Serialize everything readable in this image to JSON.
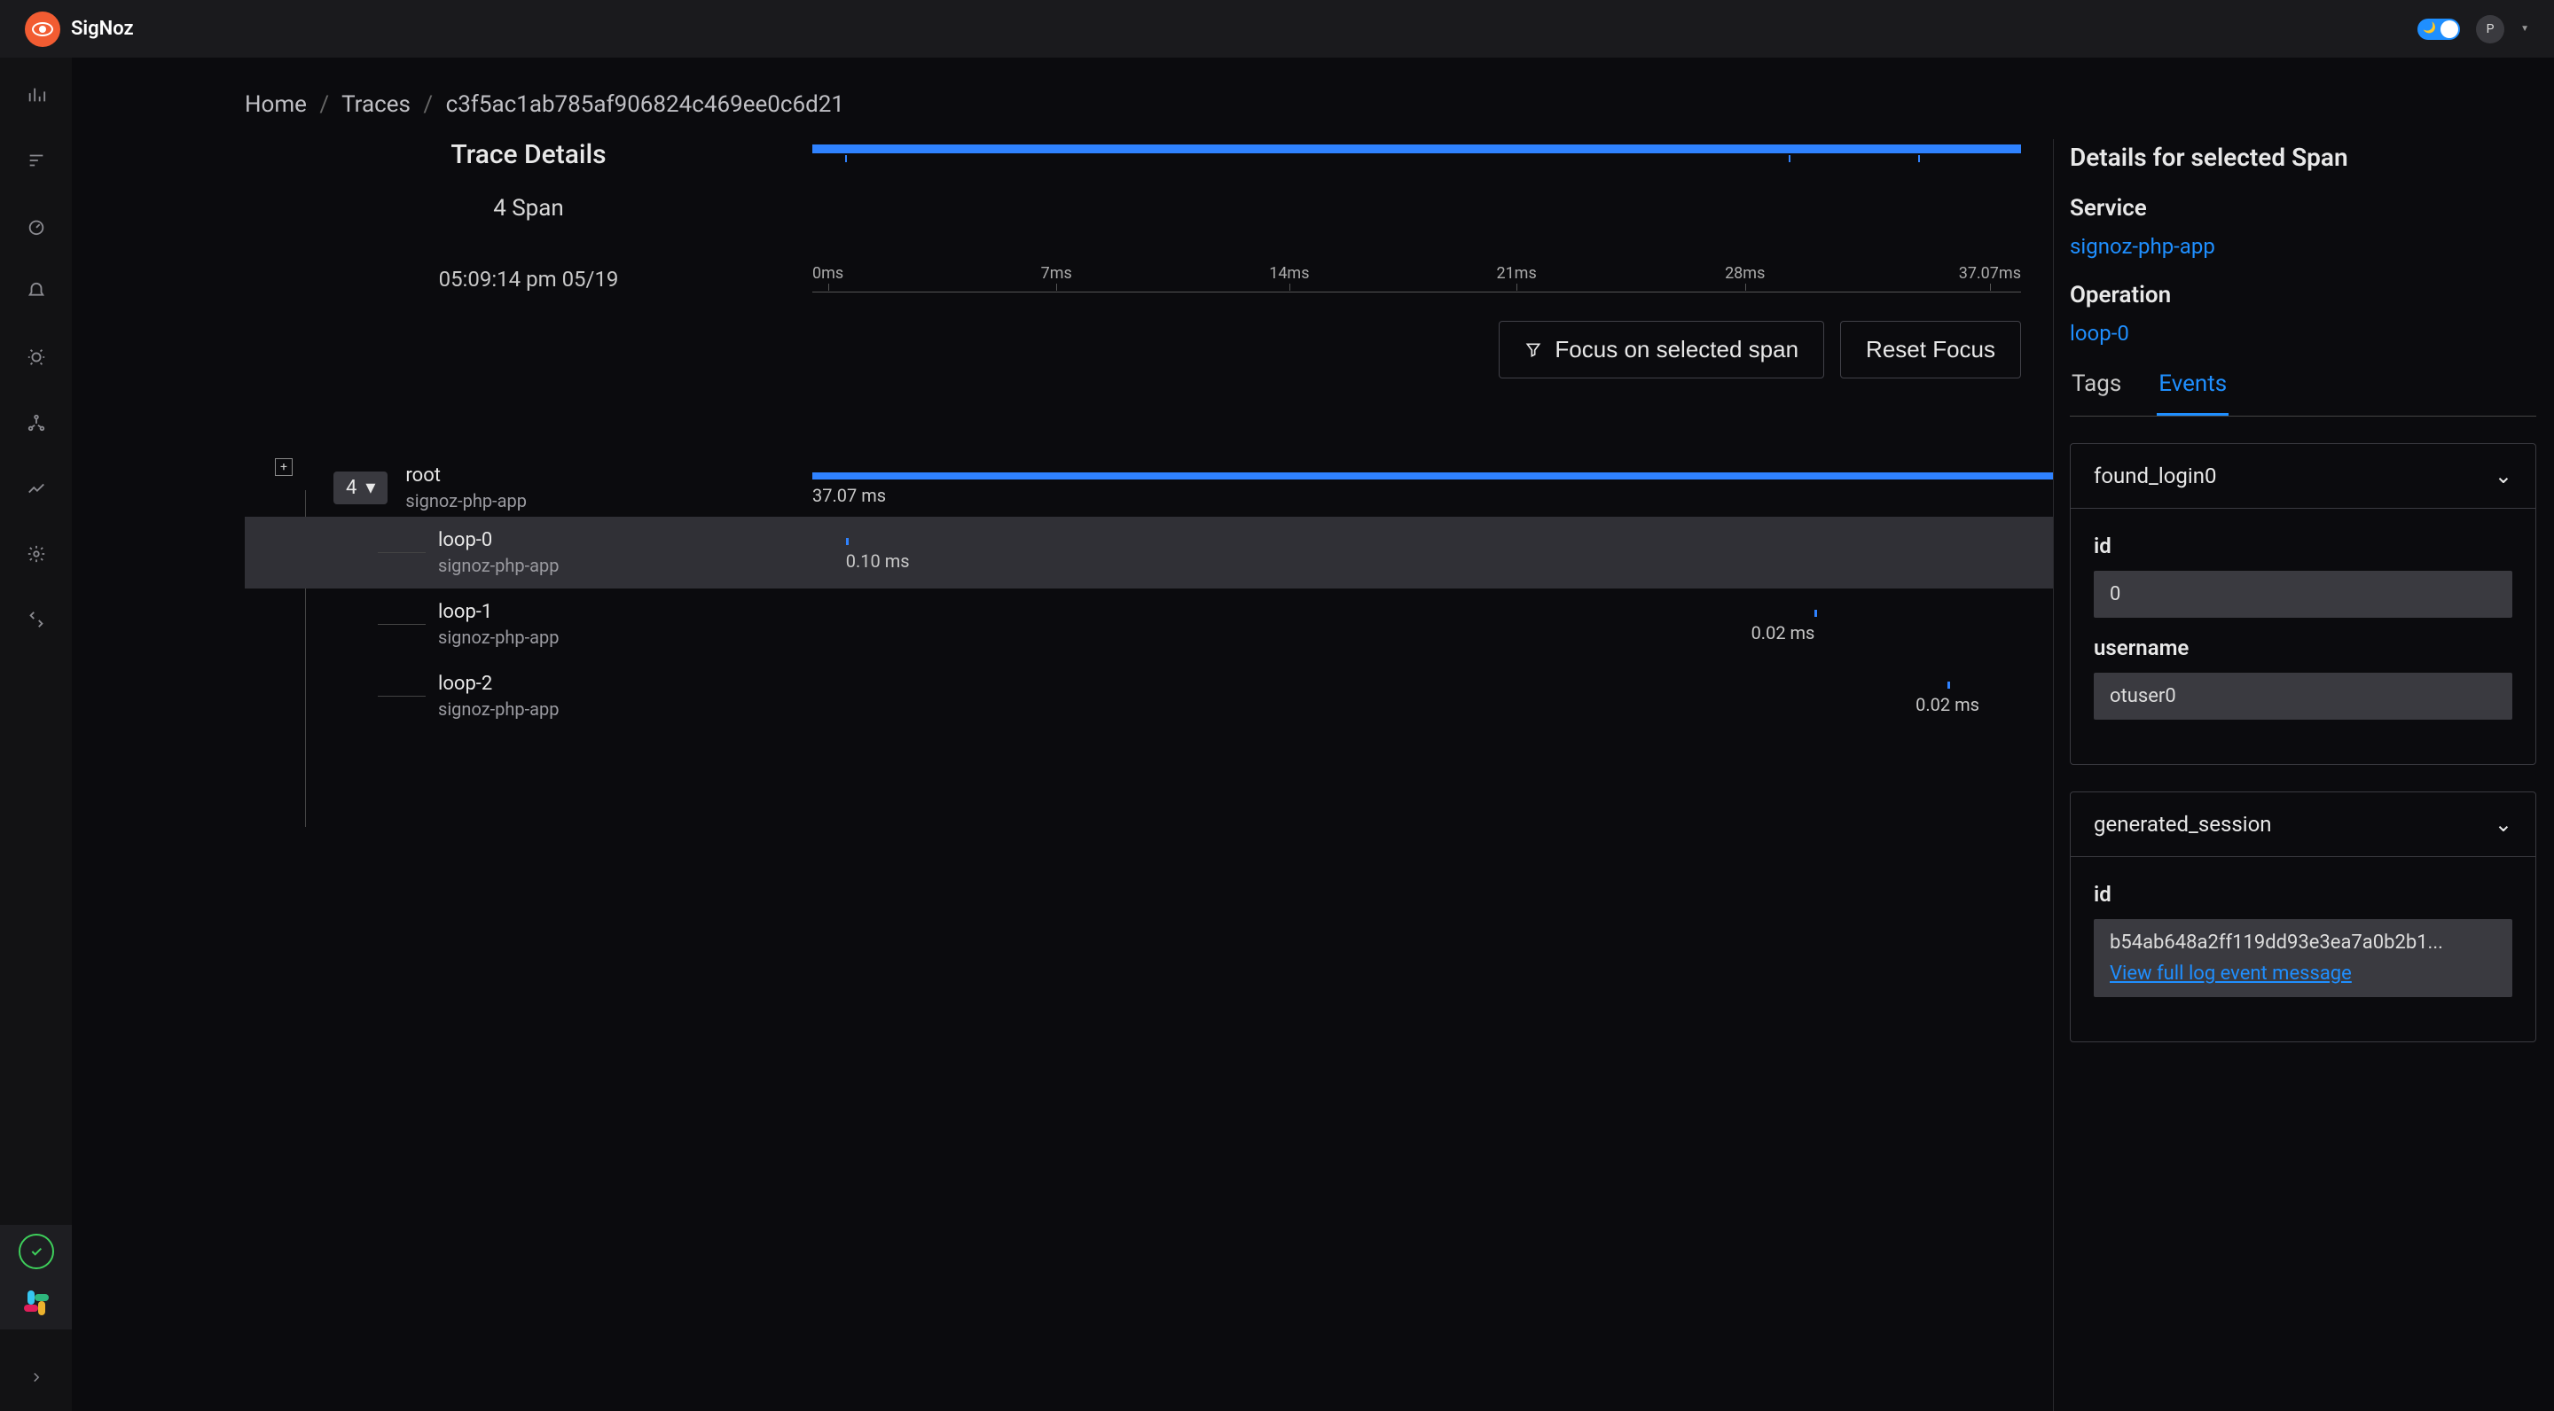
{
  "app": {
    "name": "SigNoz"
  },
  "user": {
    "initial": "P"
  },
  "breadcrumb": {
    "home": "Home",
    "traces": "Traces",
    "id": "c3f5ac1ab785af906824c469ee0c6d21"
  },
  "trace": {
    "title": "Trace Details",
    "span_count_label": "4 Span",
    "timestamp": "05:09:14 pm 05/19",
    "ticks": [
      "0ms",
      "7ms",
      "14ms",
      "21ms",
      "28ms",
      "37.07ms"
    ],
    "focus_btn": "Focus on selected span",
    "reset_btn": "Reset Focus",
    "root_count": "4"
  },
  "spans": [
    {
      "name": "root",
      "service": "signoz-php-app",
      "duration": "37.07 ms",
      "left_pct": 0,
      "width_pct": 100,
      "dur_left_pct": 0
    },
    {
      "name": "loop-0",
      "service": "signoz-php-app",
      "duration": "0.10 ms",
      "left_pct": 2.7,
      "width_pct": 0.3,
      "dur_left_pct": 2.7
    },
    {
      "name": "loop-1",
      "service": "signoz-php-app",
      "duration": "0.02 ms",
      "left_pct": 80.8,
      "width_pct": 0.3,
      "dur_left_pct": 80.8
    },
    {
      "name": "loop-2",
      "service": "signoz-php-app",
      "duration": "0.02 ms",
      "left_pct": 91.5,
      "width_pct": 0.3,
      "dur_left_pct": 91.5
    }
  ],
  "details": {
    "heading": "Details for selected Span",
    "service_label": "Service",
    "service": "signoz-php-app",
    "operation_label": "Operation",
    "operation": "loop-0",
    "tabs": {
      "tags": "Tags",
      "events": "Events"
    }
  },
  "events": [
    {
      "name": "found_login0",
      "expanded": true,
      "fields": [
        {
          "label": "id",
          "value": "0"
        },
        {
          "label": "username",
          "value": "otuser0"
        }
      ]
    },
    {
      "name": "generated_session",
      "expanded": true,
      "fields": [
        {
          "label": "id",
          "value": "b54ab648a2ff119dd93e3ea7a0b2b1...",
          "link": "View full log event message"
        }
      ]
    }
  ]
}
